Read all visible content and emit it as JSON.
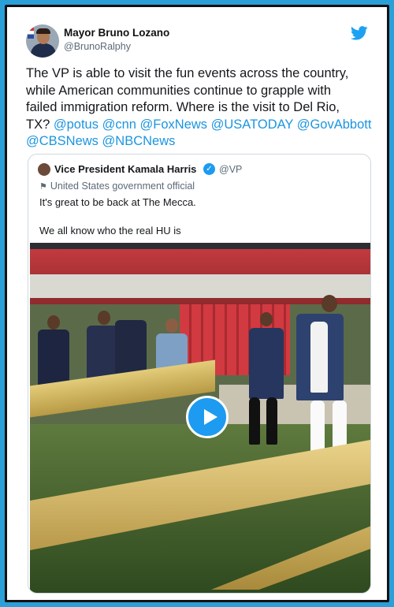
{
  "tweet": {
    "author_name": "Mayor Bruno Lozano",
    "author_handle": "@BrunoRalphy",
    "text_lines": [
      "The VP is able to visit the fun events across the country,",
      "while American communities continue to grapple with",
      "failed immigration reform. Where is the visit to Del Rio,"
    ],
    "text_last_prefix": "TX? ",
    "mentions_line4": [
      "@potus",
      "@cnn",
      "@FoxNews",
      "@USATODAY",
      "@GovAbbott"
    ],
    "mentions_line5": [
      "@CBSNews",
      "@NBCNews"
    ]
  },
  "quoted": {
    "author_name": "Vice President Kamala Harris",
    "author_handle": "@VP",
    "label": "United States government official",
    "text1": "It's great to be back at The Mecca.",
    "text2": "We all know who the real HU is"
  },
  "icons": {
    "brand": "twitter-bird-icon",
    "verified": "verified-badge-icon",
    "label": "flag-icon",
    "play": "play-icon"
  },
  "colors": {
    "accent": "#1b95e0",
    "frame": "#2a9fd8"
  }
}
